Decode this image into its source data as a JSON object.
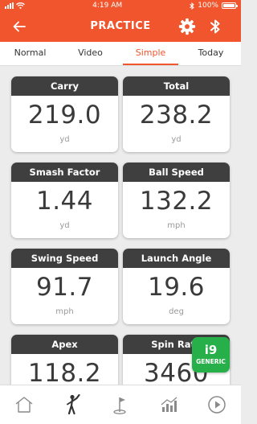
{
  "status_bar": {
    "time": "4:19 AM",
    "battery": "100%",
    "battery_level": 1.0
  },
  "header": {
    "title": "PRACTICE",
    "icons": [
      "back-arrow-icon",
      "gear-icon",
      "bluetooth-icon"
    ]
  },
  "tabs": [
    {
      "label": "Normal",
      "active": false
    },
    {
      "label": "Video",
      "active": false
    },
    {
      "label": "Simple",
      "active": true
    },
    {
      "label": "Today",
      "active": false
    }
  ],
  "metrics": [
    {
      "label": "Carry",
      "value": "219.0",
      "unit": "yd"
    },
    {
      "label": "Total",
      "value": "238.2",
      "unit": "yd"
    },
    {
      "label": "Smash Factor",
      "value": "1.44",
      "unit": "yd"
    },
    {
      "label": "Ball Speed",
      "value": "132.2",
      "unit": "mph"
    },
    {
      "label": "Swing Speed",
      "value": "91.7",
      "unit": "mph"
    },
    {
      "label": "Launch Angle",
      "value": "19.6",
      "unit": "deg"
    },
    {
      "label": "Apex",
      "value": "118.2",
      "unit": ""
    },
    {
      "label": "Spin Rate",
      "value": "3460",
      "unit": ""
    }
  ],
  "device_badge": {
    "model": "i9",
    "type": "GENERIC"
  },
  "bottom_nav": {
    "icons": [
      "home-icon",
      "golfer-icon",
      "flag-icon",
      "stats-icon",
      "play-icon"
    ],
    "active": "golfer-icon"
  },
  "colors": {
    "accent": "#f0552d",
    "card_header": "#3f3f3f",
    "badge": "#27b04a"
  }
}
